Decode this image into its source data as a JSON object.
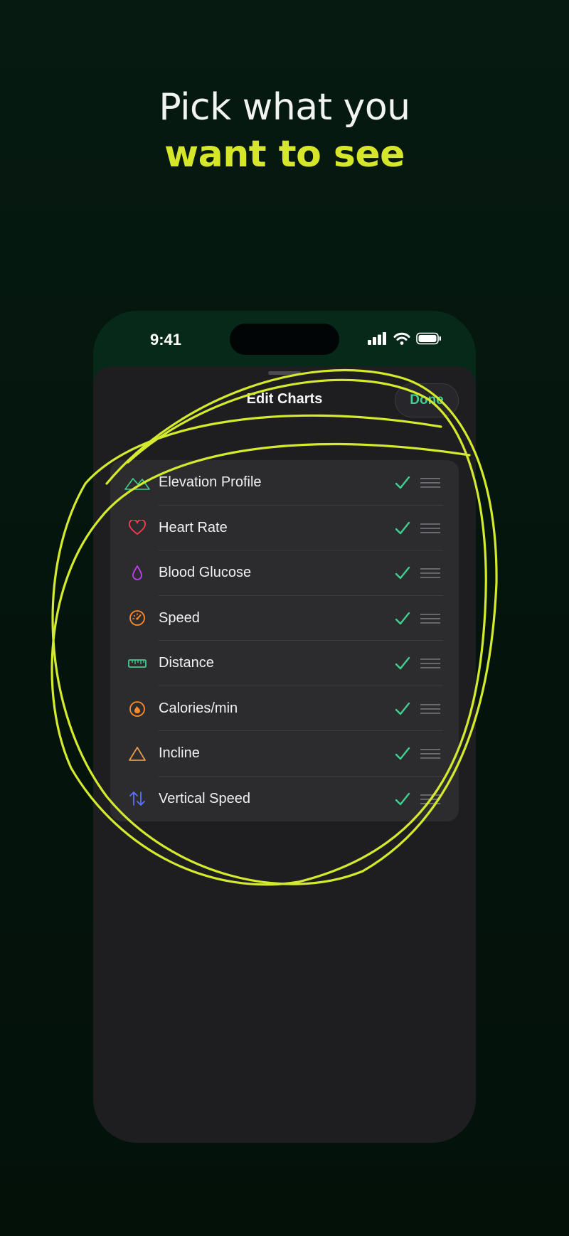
{
  "headline": {
    "line1": "Pick what you",
    "line2": "want to see"
  },
  "status_bar": {
    "time": "9:41",
    "icons": [
      "signal-icon",
      "wifi-icon",
      "battery-icon"
    ]
  },
  "sheet": {
    "title": "Edit Charts",
    "done_label": "Done"
  },
  "charts": [
    {
      "label": "Elevation Profile",
      "icon": "mountain-icon",
      "color": "#3fcf8e",
      "checked": true
    },
    {
      "label": "Heart Rate",
      "icon": "heart-icon",
      "color": "#ff3b4e",
      "checked": true
    },
    {
      "label": "Blood Glucose",
      "icon": "drop-icon",
      "color": "#c23cf0",
      "checked": true
    },
    {
      "label": "Speed",
      "icon": "speedometer-icon",
      "color": "#ff8a2a",
      "checked": true
    },
    {
      "label": "Distance",
      "icon": "ruler-icon",
      "color": "#3fcf8e",
      "checked": true
    },
    {
      "label": "Calories/min",
      "icon": "flame-icon",
      "color": "#ff8a2a",
      "checked": true
    },
    {
      "label": "Incline",
      "icon": "triangle-icon",
      "color": "#e39a4a",
      "checked": true
    },
    {
      "label": "Vertical Speed",
      "icon": "up-down-arrows-icon",
      "color": "#5b72ff",
      "checked": true
    }
  ],
  "colors": {
    "accent": "#d6e62a",
    "check": "#3fcf8e",
    "background": "#04140d",
    "sheet": "#1e1e21"
  }
}
